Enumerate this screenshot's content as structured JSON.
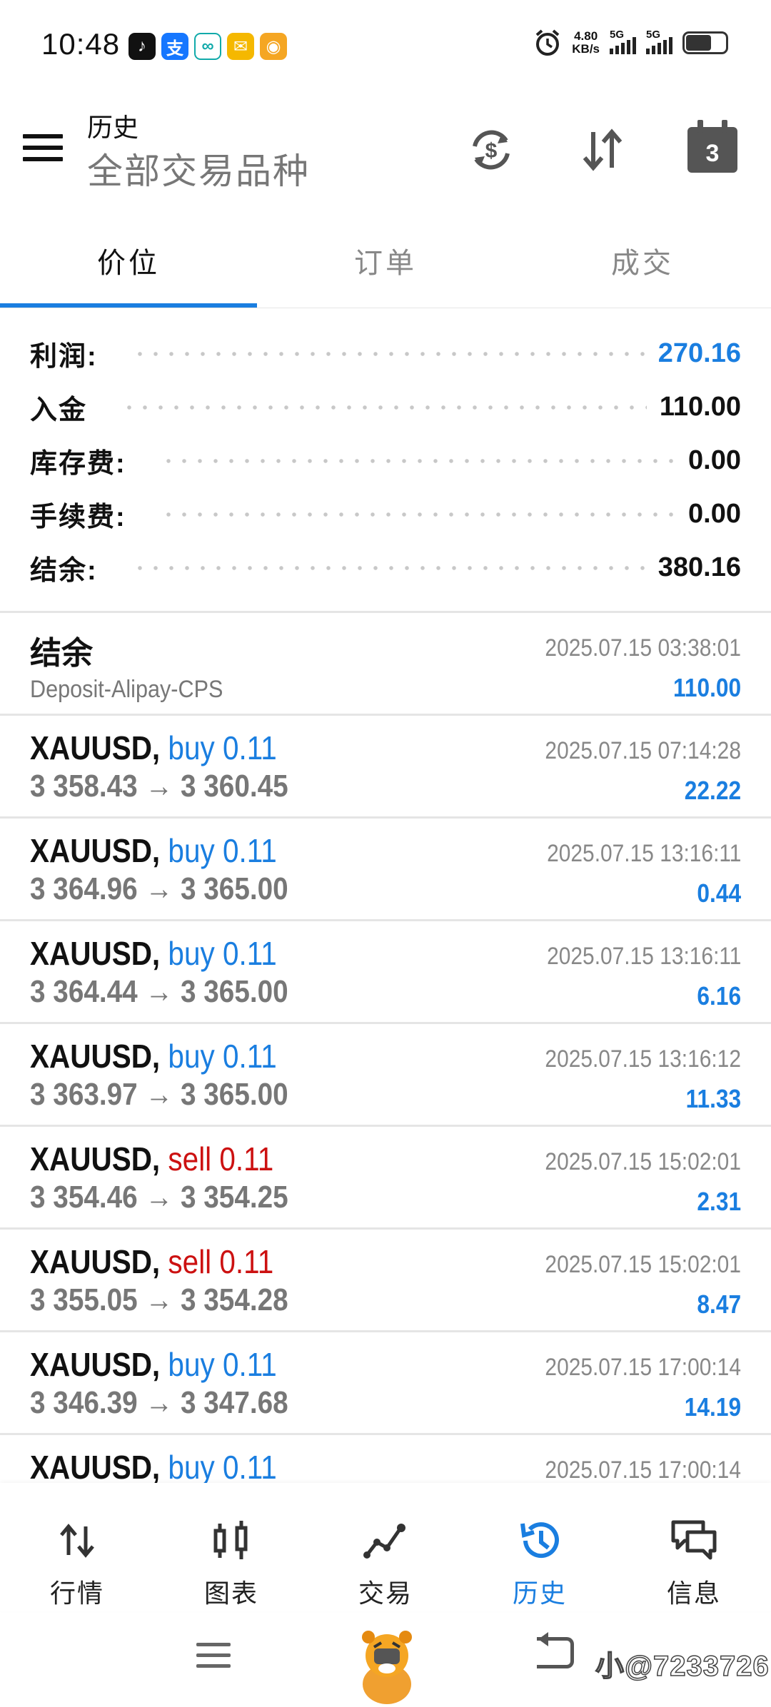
{
  "status_bar": {
    "time": "10:48",
    "net_speed_value": "4.80",
    "net_speed_unit": "KB/s",
    "sim1_label": "5G",
    "sim2_label": "5G",
    "apps": [
      "tiktok-icon",
      "alipay-icon",
      "china-mobile-icon",
      "mail-icon",
      "weibo-icon"
    ]
  },
  "header": {
    "title": "历史",
    "subtitle": "全部交易品种",
    "calendar_day": "3"
  },
  "tabs": [
    {
      "label": "价位",
      "active": true
    },
    {
      "label": "订单",
      "active": false
    },
    {
      "label": "成交",
      "active": false
    }
  ],
  "summary": [
    {
      "label": "利润:",
      "value": "270.16",
      "highlight": true
    },
    {
      "label": "入金",
      "value": "110.00",
      "highlight": false
    },
    {
      "label": "库存费:",
      "value": "0.00",
      "highlight": false
    },
    {
      "label": "手续费:",
      "value": "0.00",
      "highlight": false
    },
    {
      "label": "结余:",
      "value": "380.16",
      "highlight": false
    }
  ],
  "deposit": {
    "title": "结余",
    "comment": "Deposit-Alipay-CPS",
    "time": "2025.07.15 03:38:01",
    "amount": "110.00"
  },
  "trades": [
    {
      "symbol": "XAUUSD,",
      "side": "buy 0.11",
      "type": "buy",
      "prices": "3 358.43 → 3 360.45",
      "time": "2025.07.15 07:14:28",
      "profit": "22.22"
    },
    {
      "symbol": "XAUUSD,",
      "side": "buy 0.11",
      "type": "buy",
      "prices": "3 364.96 → 3 365.00",
      "time": "2025.07.15 13:16:11",
      "profit": "0.44"
    },
    {
      "symbol": "XAUUSD,",
      "side": "buy 0.11",
      "type": "buy",
      "prices": "3 364.44 → 3 365.00",
      "time": "2025.07.15 13:16:11",
      "profit": "6.16"
    },
    {
      "symbol": "XAUUSD,",
      "side": "buy 0.11",
      "type": "buy",
      "prices": "3 363.97 → 3 365.00",
      "time": "2025.07.15 13:16:12",
      "profit": "11.33"
    },
    {
      "symbol": "XAUUSD,",
      "side": "sell 0.11",
      "type": "sell",
      "prices": "3 354.46 → 3 354.25",
      "time": "2025.07.15 15:02:01",
      "profit": "2.31"
    },
    {
      "symbol": "XAUUSD,",
      "side": "sell 0.11",
      "type": "sell",
      "prices": "3 355.05 → 3 354.28",
      "time": "2025.07.15 15:02:01",
      "profit": "8.47"
    },
    {
      "symbol": "XAUUSD,",
      "side": "buy 0.11",
      "type": "buy",
      "prices": "3 346.39 → 3 347.68",
      "time": "2025.07.15 17:00:14",
      "profit": "14.19"
    },
    {
      "symbol": "XAUUSD,",
      "side": "buy 0.11",
      "type": "buy",
      "prices": "",
      "time": "2025.07.15 17:00:14",
      "profit": ""
    }
  ],
  "bottom_nav": [
    {
      "label": "行情",
      "icon": "quotes-icon",
      "active": false
    },
    {
      "label": "图表",
      "icon": "chart-icon",
      "active": false
    },
    {
      "label": "交易",
      "icon": "trade-icon",
      "active": false
    },
    {
      "label": "历史",
      "icon": "history-icon",
      "active": true
    },
    {
      "label": "信息",
      "icon": "messages-icon",
      "active": false
    }
  ],
  "watermark": "小@7233726",
  "colors": {
    "accent": "#1a7ee0",
    "sell": "#cc1111",
    "muted": "#777777"
  }
}
